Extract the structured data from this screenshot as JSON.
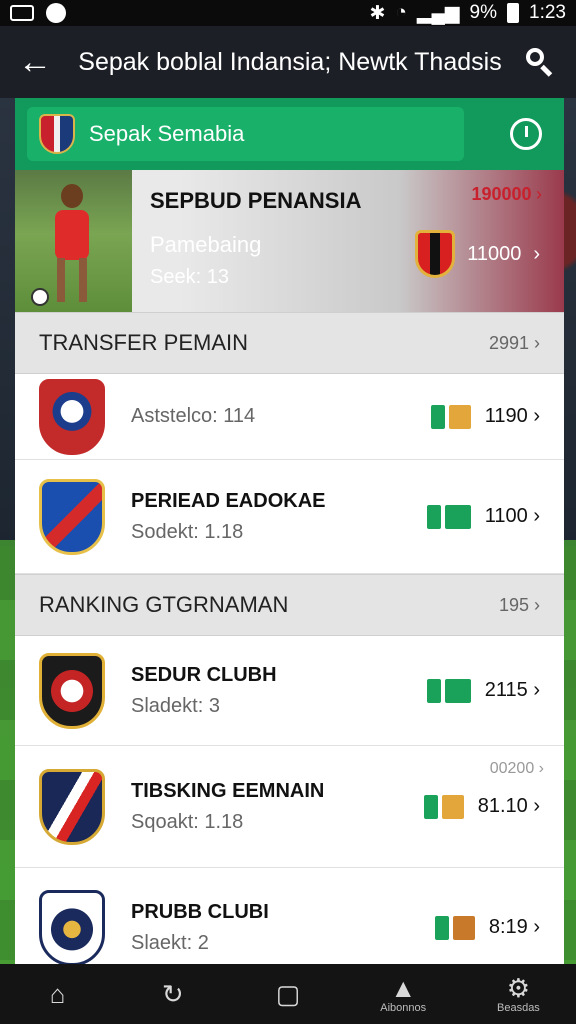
{
  "status_bar": {
    "battery": "9%",
    "time": "1:23"
  },
  "app_bar": {
    "title": "Sepak boblal Indansia; Newtk  Thadsis"
  },
  "header": {
    "label": "Sepak Semabia"
  },
  "hero": {
    "title": "SEPBUD PENANSIA",
    "subtitle": "Pamebaing",
    "meta": "Seek: 13",
    "amount": "190000",
    "value": "11000"
  },
  "sections": [
    {
      "title": "TRANSFER PEMAIN",
      "count": "2991",
      "rows": [
        {
          "title": "",
          "sub": "Aststelco: 114",
          "value": "1190"
        },
        {
          "title": "PERIEAD EADOKAE",
          "sub": "Sodekt: 1.18",
          "value": "1100"
        }
      ]
    },
    {
      "title": "RANKING GTGRNAMAN",
      "count": "195",
      "rows": [
        {
          "title": "SEDUR CLUBH",
          "sub": "Sladekt:  3",
          "value": "2115",
          "extra": ""
        },
        {
          "title": "TIBSKING EEMNAIN",
          "sub": "Sqoakt: 1.18",
          "value": "81.10",
          "extra": "00200"
        },
        {
          "title": "PRUBB CLUBI",
          "sub": "Slaekt: 2",
          "value": "8:19"
        }
      ]
    }
  ],
  "bottom_nav": {
    "items": [
      {
        "icon": "home-icon",
        "label": ""
      },
      {
        "icon": "refresh-icon",
        "label": ""
      },
      {
        "icon": "bag-icon",
        "label": ""
      },
      {
        "icon": "trophy-icon",
        "label": "Aibonnos"
      },
      {
        "icon": "settings-icon",
        "label": "Beasdas"
      }
    ]
  },
  "colors": {
    "accent_green": "#129a5c",
    "app_bar": "#1d1f26",
    "red": "#c8202c"
  }
}
